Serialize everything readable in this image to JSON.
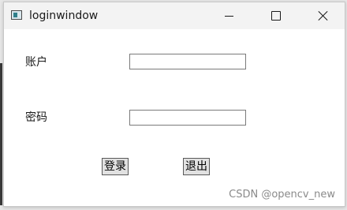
{
  "window": {
    "title": "loginwindow",
    "app_icon": "app-window-icon",
    "controls": {
      "minimize_icon": "minimize-icon",
      "maximize_icon": "maximize-icon",
      "close_icon": "close-icon"
    }
  },
  "form": {
    "account_label": "账户",
    "account_value": "",
    "password_label": "密码",
    "password_value": ""
  },
  "buttons": {
    "login_label": "登录",
    "exit_label": "退出"
  },
  "watermark": "CSDN @opencv_new",
  "colors": {
    "titlebar_bg": "#f3f3f3",
    "window_bg": "#ffffff",
    "button_bg": "#e1e1e1",
    "watermark_text": "#8a8a8a"
  }
}
